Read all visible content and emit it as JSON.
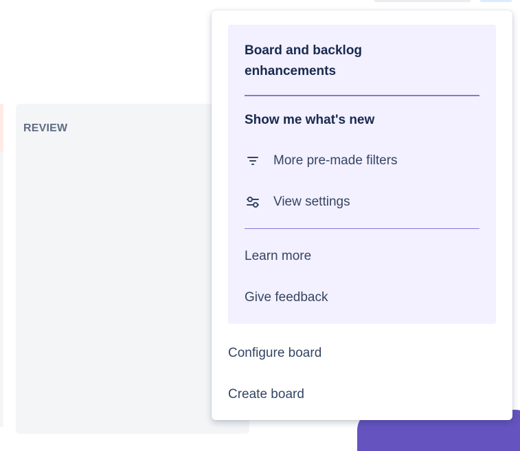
{
  "board": {
    "column_title": "REVIEW"
  },
  "menu": {
    "spotlight": {
      "title": "Board and backlog enhancements",
      "section_heading": "Show me what's new",
      "items": [
        {
          "label": "More pre-made filters",
          "icon": "filter-icon"
        },
        {
          "label": "View settings",
          "icon": "sliders-icon"
        }
      ],
      "links": [
        {
          "label": "Learn more"
        },
        {
          "label": "Give feedback"
        }
      ]
    },
    "items": [
      {
        "label": "Configure board"
      },
      {
        "label": "Create board"
      }
    ]
  },
  "colors": {
    "spotlight_bg": "#f3f0ff",
    "spotlight_divider": "#8777d9",
    "text_primary": "#172b4d",
    "text_secondary": "#344563",
    "column_bg": "#f4f5f7",
    "accent_purple": "#6554c0"
  }
}
